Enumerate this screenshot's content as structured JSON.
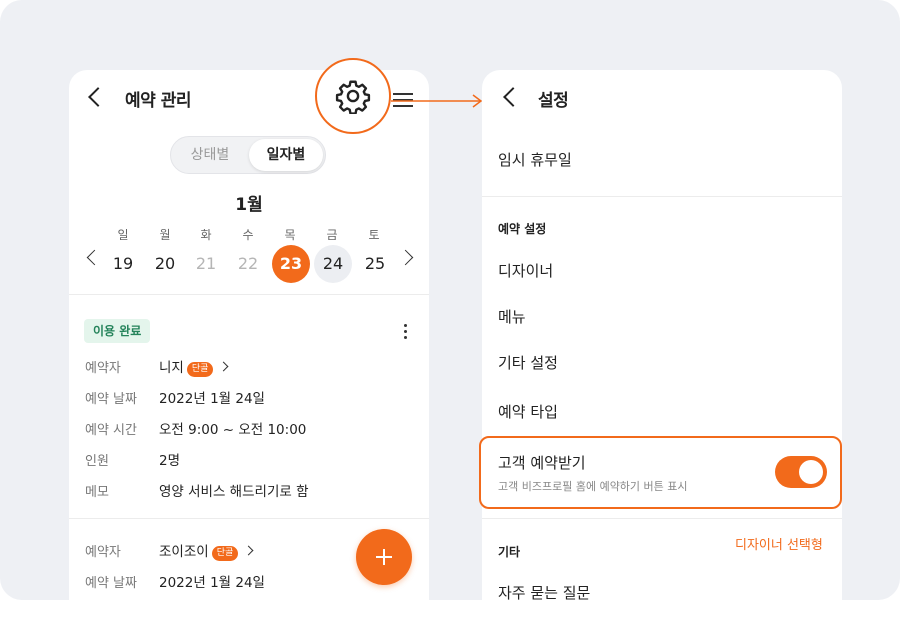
{
  "left_screen": {
    "title": "예약 관리",
    "view_toggle": {
      "options": [
        "상태별",
        "일자별"
      ],
      "selected": "일자별"
    },
    "month": "1월",
    "weekdays": [
      "일",
      "월",
      "화",
      "수",
      "목",
      "금",
      "토"
    ],
    "dates": [
      "19",
      "20",
      "21",
      "22",
      "23",
      "24",
      "25"
    ],
    "selected_date": "23",
    "today_date": "24",
    "reservation1": {
      "status": "이용 완료",
      "fields": [
        {
          "label": "예약자",
          "value": "니지",
          "tag": "단골"
        },
        {
          "label": "예약 날짜",
          "value": "2022년 1월 24일"
        },
        {
          "label": "예약 시간",
          "value": "오전 9:00 ~ 오전 10:00"
        },
        {
          "label": "인원",
          "value": "2명"
        },
        {
          "label": "메모",
          "value": "영양 서비스 해드리기로 함"
        }
      ]
    },
    "reservation2": {
      "fields": [
        {
          "label": "예약자",
          "value": "조이조이",
          "tag": "단골"
        },
        {
          "label": "예약 날짜",
          "value": "2022년 1월 24일"
        }
      ]
    }
  },
  "right_screen": {
    "title": "설정",
    "items": {
      "holiday": "임시 휴무일",
      "section_reservation": "예약 설정",
      "designer": "디자이너",
      "menu": "메뉴",
      "other_settings": "기타 설정",
      "reservation_type": "예약  타입",
      "section_etc": "기타",
      "faq": "자주 묻는 질문"
    },
    "customer_reservation": {
      "title": "고객 예약받기",
      "description": "고객 비즈프로필 홈에 예약하기 버튼 표시",
      "enabled": true
    },
    "annotation": "디자이너 선택형"
  },
  "colors": {
    "accent": "#f26a1b",
    "background": "#eef0f4",
    "badge_green": "#24835a"
  }
}
